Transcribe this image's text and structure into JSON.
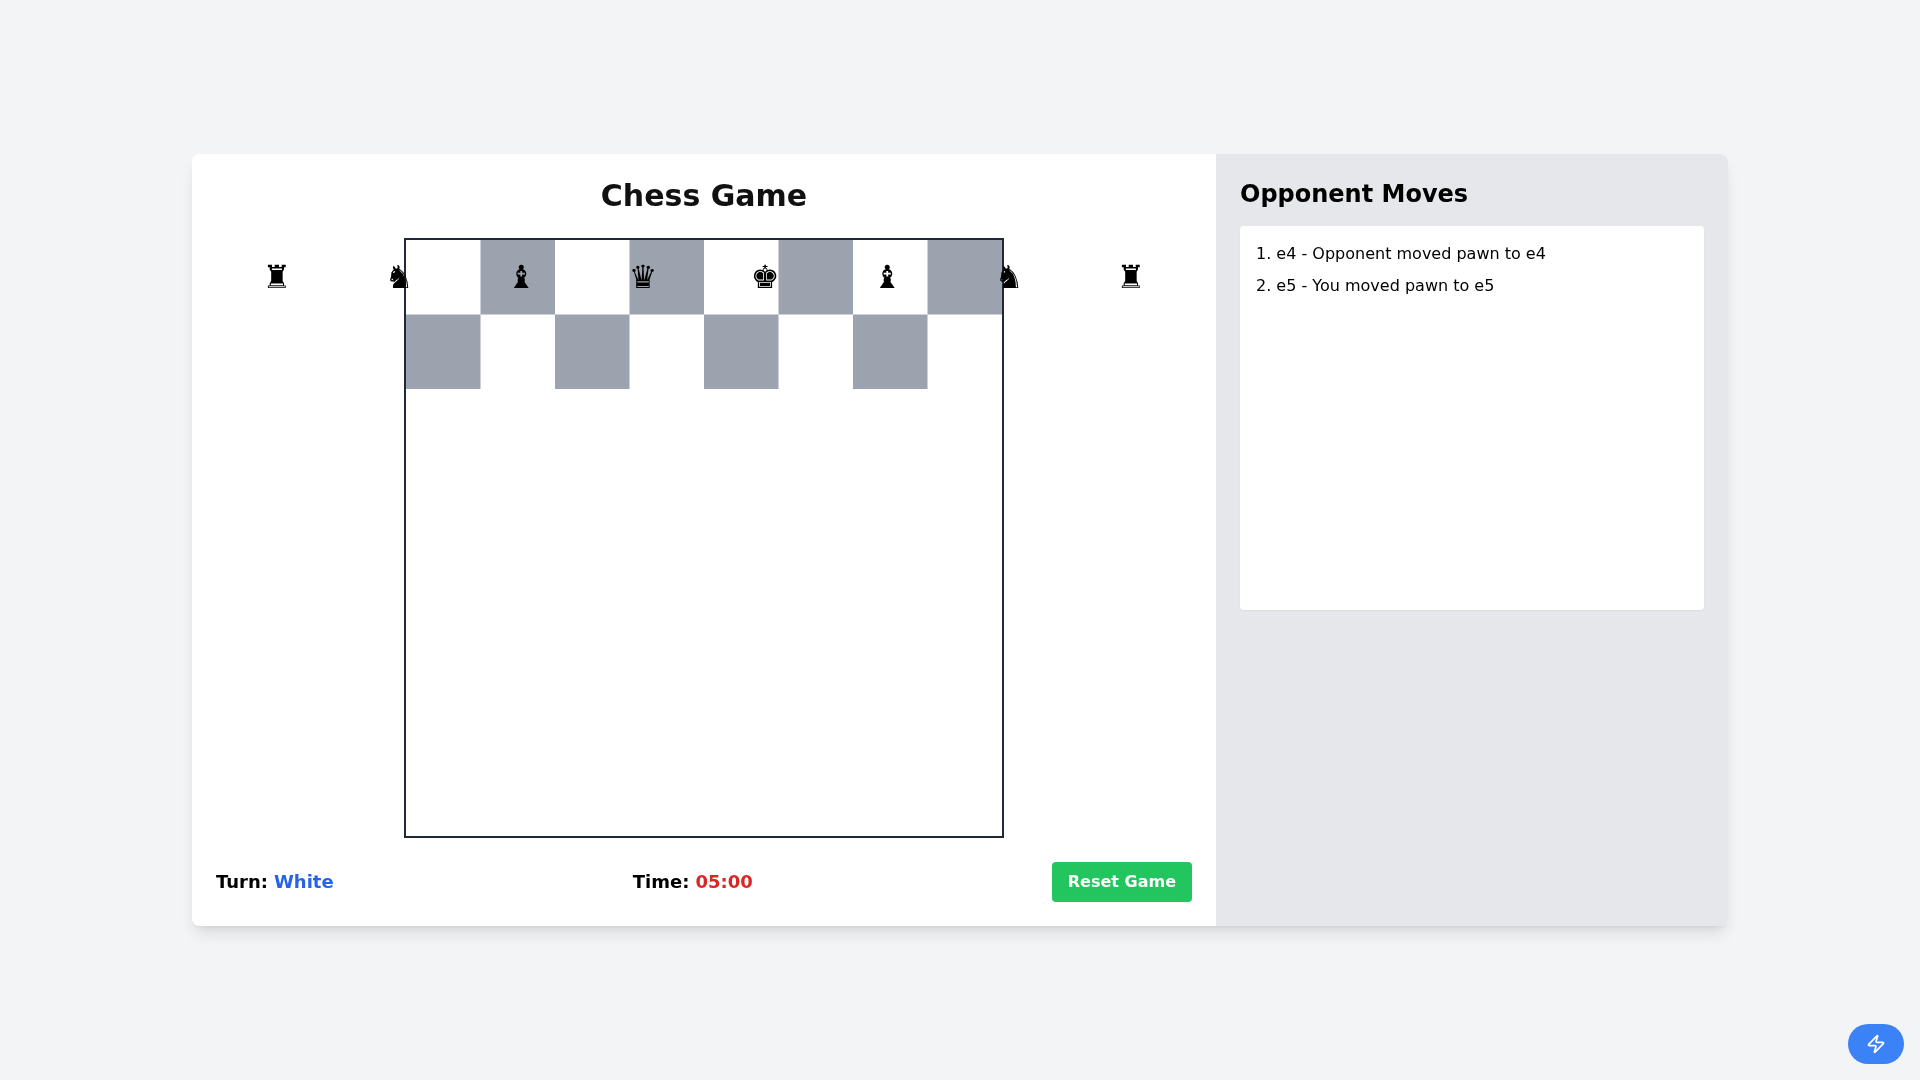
{
  "game": {
    "title": "Chess Game",
    "pieces": [
      "♜",
      "♞",
      "♝",
      "♛",
      "♚",
      "♝",
      "♞",
      "♜"
    ],
    "turn": {
      "label": "Turn:",
      "value": "White"
    },
    "time": {
      "label": "Time:",
      "value": "05:00"
    },
    "reset_button": "Reset Game"
  },
  "moves_panel": {
    "title": "Opponent Moves",
    "moves": [
      "1. e4 - Opponent moved pawn to e4",
      "2. e5 - You moved pawn to e5"
    ]
  }
}
